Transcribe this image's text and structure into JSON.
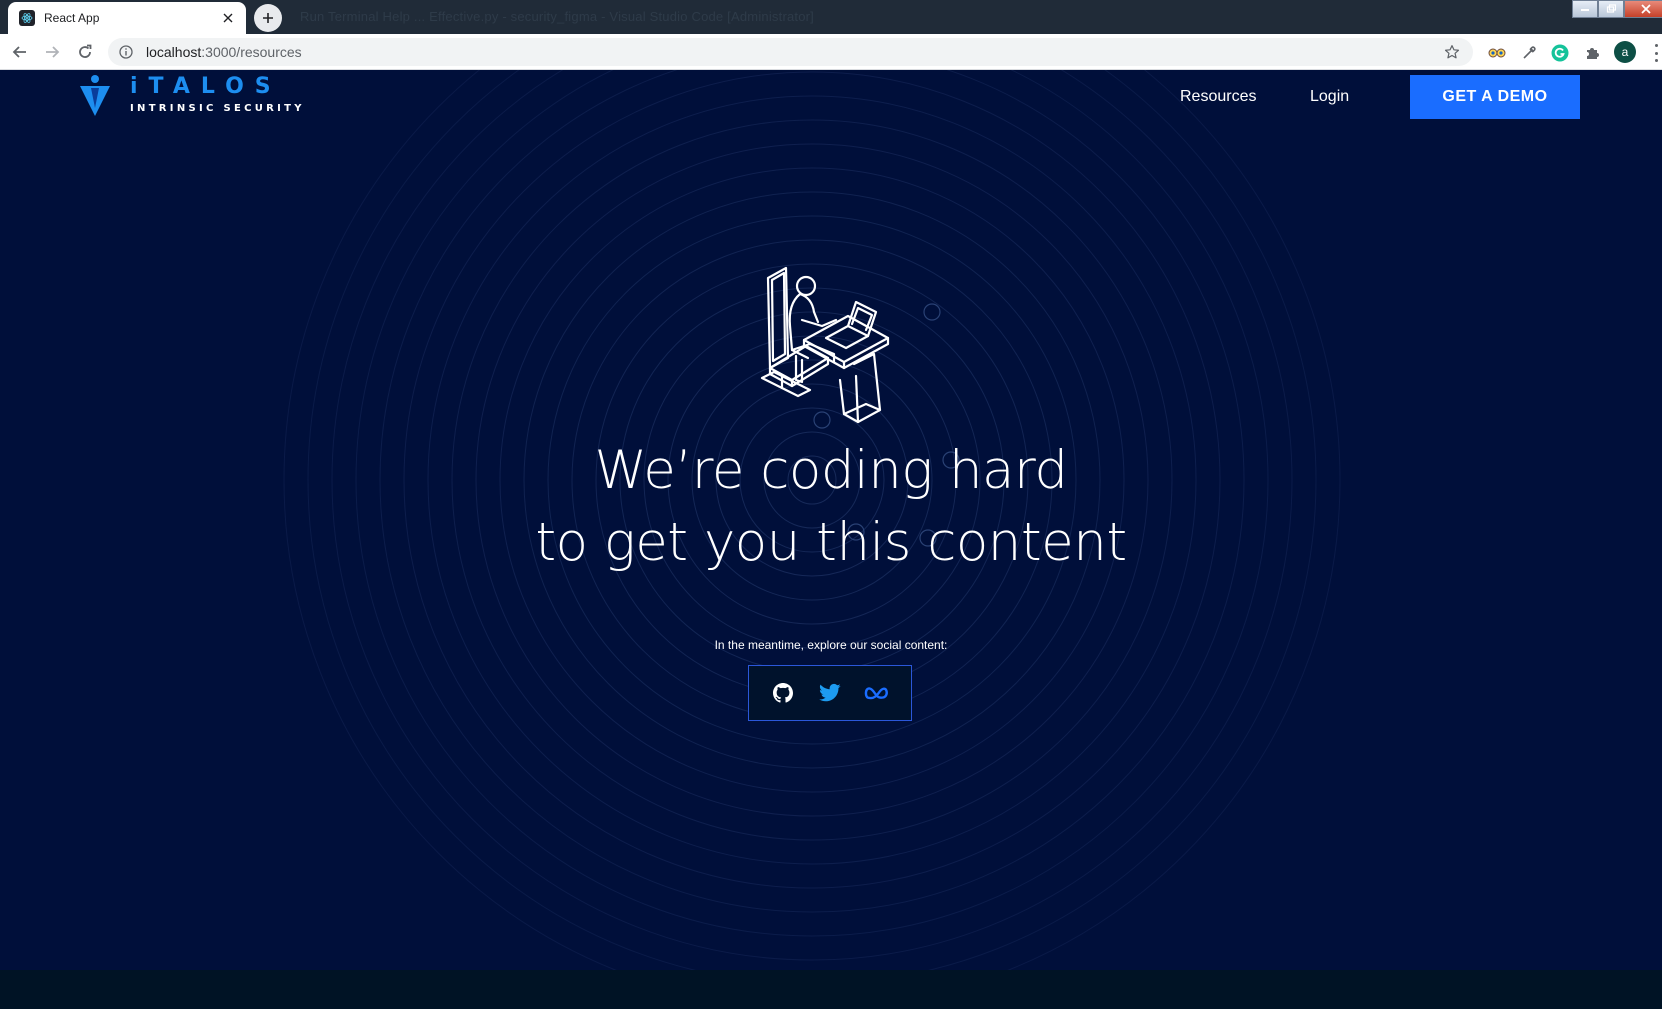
{
  "browser": {
    "tab_title": "React App",
    "url_host": "localhost",
    "url_rest": ":3000/resources",
    "background_window_title": "Run   Terminal   Help              ...   Effective.py - security_figma - Visual Studio Code [Administrator]",
    "profile_initial": "a"
  },
  "site": {
    "logo_word": "iTALOS",
    "logo_tagline": "INTRINSIC SECURITY",
    "nav": {
      "resources": "Resources",
      "login": "Login",
      "demo_button": "GET A DEMO"
    },
    "headline_line1": "We’re coding hard",
    "headline_line2": "to get you this content",
    "social_prompt": "In the meantime, explore our social content:",
    "social_icons": [
      "github-icon",
      "twitter-icon",
      "meta-icon"
    ]
  },
  "colors": {
    "page_background": "#000f3a",
    "accent_blue": "#1a6dff",
    "logo_blue": "#1d8ef0",
    "twitter_blue": "#1d9bf0",
    "social_border": "#2b57d9"
  }
}
